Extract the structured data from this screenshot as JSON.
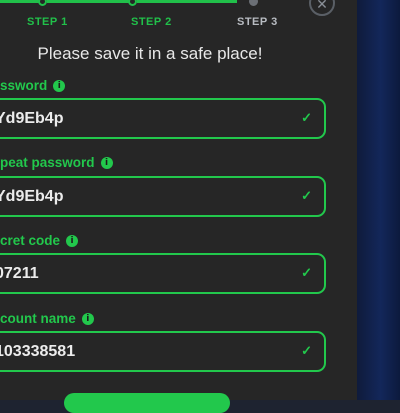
{
  "stepper": {
    "steps": [
      {
        "label": "STEP 1",
        "state": "done"
      },
      {
        "label": "STEP 2",
        "state": "active"
      },
      {
        "label": "STEP 3",
        "state": "inactive"
      }
    ],
    "progress_fraction": 0.6
  },
  "close_icon": "close-icon",
  "headline": "Please save it in a safe place!",
  "fields": {
    "password": {
      "label": "ssword",
      "value": "Yd9Eb4p",
      "info_icon": "info-icon",
      "valid": true
    },
    "repeat_password": {
      "label": "peat password",
      "value": "Yd9Eb4p",
      "info_icon": "info-icon",
      "valid": true
    },
    "secret_code": {
      "label": "cret code",
      "value": "07211",
      "info_icon": "info-icon",
      "valid": true
    },
    "account_name": {
      "label": "count name",
      "value": "103338581",
      "info_icon": "info-icon",
      "valid": true
    }
  },
  "check_glyph": "✓",
  "info_glyph": "i",
  "colors": {
    "accent": "#22c84c",
    "panel": "#262626",
    "backdrop": "#13275a",
    "text": "#e8e8e8"
  }
}
